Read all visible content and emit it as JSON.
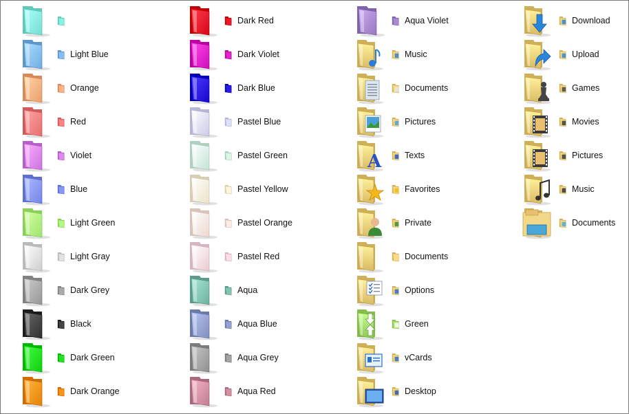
{
  "columns": [
    {
      "type": "colored",
      "items": [
        {
          "label": "",
          "color": "#7ee8d8",
          "icon": "aqua-folder-icon"
        },
        {
          "label": "Light Blue",
          "color": "#7cb4ec",
          "icon": "light-blue-folder-icon"
        },
        {
          "label": "Orange",
          "color": "#f5a878",
          "icon": "orange-folder-icon"
        },
        {
          "label": "Red",
          "color": "#f07878",
          "icon": "red-folder-icon"
        },
        {
          "label": "Violet",
          "color": "#d47ee8",
          "icon": "violet-folder-icon"
        },
        {
          "label": "Blue",
          "color": "#7e8ef0",
          "icon": "blue-folder-icon"
        },
        {
          "label": "Light Green",
          "color": "#a8ee78",
          "icon": "light-green-folder-icon"
        },
        {
          "label": "Light Gray",
          "color": "#d8d8d8",
          "icon": "light-gray-folder-icon"
        },
        {
          "label": "Dark Grey",
          "color": "#a0a0a0",
          "icon": "dark-grey-folder-icon"
        },
        {
          "label": "Black",
          "color": "#3a3a3a",
          "icon": "black-folder-icon"
        },
        {
          "label": "Dark Green",
          "color": "#18d818",
          "icon": "dark-green-folder-icon"
        },
        {
          "label": "Dark Orange",
          "color": "#f08a10",
          "icon": "dark-orange-folder-icon"
        }
      ]
    },
    {
      "type": "colored",
      "items": [
        {
          "label": "Dark Red",
          "color": "#e01020",
          "icon": "dark-red-folder-icon"
        },
        {
          "label": "Dark Violet",
          "color": "#d818c0",
          "icon": "dark-violet-folder-icon"
        },
        {
          "label": "Dark Blue",
          "color": "#2010d8",
          "icon": "dark-blue-folder-icon"
        },
        {
          "label": "Pastel Blue",
          "color": "#d4d4f4",
          "icon": "pastel-blue-folder-icon"
        },
        {
          "label": "Pastel Green",
          "color": "#cfeedd",
          "icon": "pastel-green-folder-icon"
        },
        {
          "label": "Pastel Yellow",
          "color": "#f6ecd2",
          "icon": "pastel-yellow-folder-icon"
        },
        {
          "label": "Pastel Orange",
          "color": "#f6e2d8",
          "icon": "pastel-orange-folder-icon"
        },
        {
          "label": "Pastel Red",
          "color": "#f4d4dc",
          "icon": "pastel-red-folder-icon"
        },
        {
          "label": "Aqua",
          "color": "#7abaa8",
          "icon": "aqua-teal-folder-icon"
        },
        {
          "label": "Aqua Blue",
          "color": "#8a98c8",
          "icon": "aqua-blue-folder-icon"
        },
        {
          "label": "Aqua Grey",
          "color": "#9a9a9a",
          "icon": "aqua-grey-folder-icon"
        },
        {
          "label": "Aqua Red",
          "color": "#c8889a",
          "icon": "aqua-red-folder-icon"
        }
      ]
    },
    {
      "type": "emblem",
      "items": [
        {
          "label": "Aqua Violet",
          "color": "#a080c8",
          "icon": "aqua-violet-folder-icon",
          "emblem": "none"
        },
        {
          "label": "Music",
          "color": "#f2d37c",
          "icon": "music-folder-icon",
          "emblem": "music"
        },
        {
          "label": "Documents",
          "color": "#f2d37c",
          "icon": "documents-folder-icon",
          "emblem": "doc"
        },
        {
          "label": "Pictures",
          "color": "#f2d37c",
          "icon": "pictures-folder-icon",
          "emblem": "picture"
        },
        {
          "label": "Texts",
          "color": "#f2d37c",
          "icon": "texts-folder-icon",
          "emblem": "text"
        },
        {
          "label": "Favorites",
          "color": "#f2d37c",
          "icon": "favorites-folder-icon",
          "emblem": "star"
        },
        {
          "label": "Private",
          "color": "#f2d37c",
          "icon": "private-folder-icon",
          "emblem": "person"
        },
        {
          "label": "Documents",
          "color": "#f2d37c",
          "icon": "documents-stack-folder-icon",
          "emblem": "none"
        },
        {
          "label": "Options",
          "color": "#f2d37c",
          "icon": "options-folder-icon",
          "emblem": "checklist"
        },
        {
          "label": "Green",
          "color": "#a8e070",
          "icon": "green-arrows-folder-icon",
          "emblem": "arrows"
        },
        {
          "label": "vCards",
          "color": "#f2d37c",
          "icon": "vcards-folder-icon",
          "emblem": "card"
        },
        {
          "label": "Desktop",
          "color": "#f2d37c",
          "icon": "desktop-folder-icon",
          "emblem": "monitor"
        }
      ]
    },
    {
      "type": "emblem",
      "items": [
        {
          "label": "Download",
          "color": "#f2d37c",
          "icon": "download-folder-icon",
          "emblem": "down-arrow"
        },
        {
          "label": "Upload",
          "color": "#f2d37c",
          "icon": "upload-folder-icon",
          "emblem": "up-arrow"
        },
        {
          "label": "Games",
          "color": "#f2d37c",
          "icon": "games-folder-icon",
          "emblem": "chess"
        },
        {
          "label": "Movies",
          "color": "#f2d37c",
          "icon": "movies-folder-icon",
          "emblem": "film"
        },
        {
          "label": "Pictures",
          "color": "#f2d37c",
          "icon": "pictures-film-folder-icon",
          "emblem": "film"
        },
        {
          "label": "Music",
          "color": "#f2d37c",
          "icon": "music-note-folder-icon",
          "emblem": "note"
        },
        {
          "label": "Documents",
          "color": "#f2d37c",
          "icon": "documents-tray-folder-icon",
          "emblem": "tray"
        }
      ]
    }
  ],
  "emblem_colors": {
    "music": "#2a7fd4",
    "doc": "#dfe6ee",
    "picture": "#4aa0d8",
    "text": "#2850c8",
    "star": "#f4b818",
    "person": "#3a8a3a",
    "checklist": "#2a6ad0",
    "arrows": "#ffffff",
    "card": "#2a70c8",
    "monitor": "#2a5aa8",
    "down-arrow": "#2a86d8",
    "up-arrow": "#2a86d8",
    "chess": "#444444",
    "film": "#3a3a3a",
    "note": "#333333",
    "tray": "#4aa8d8"
  }
}
